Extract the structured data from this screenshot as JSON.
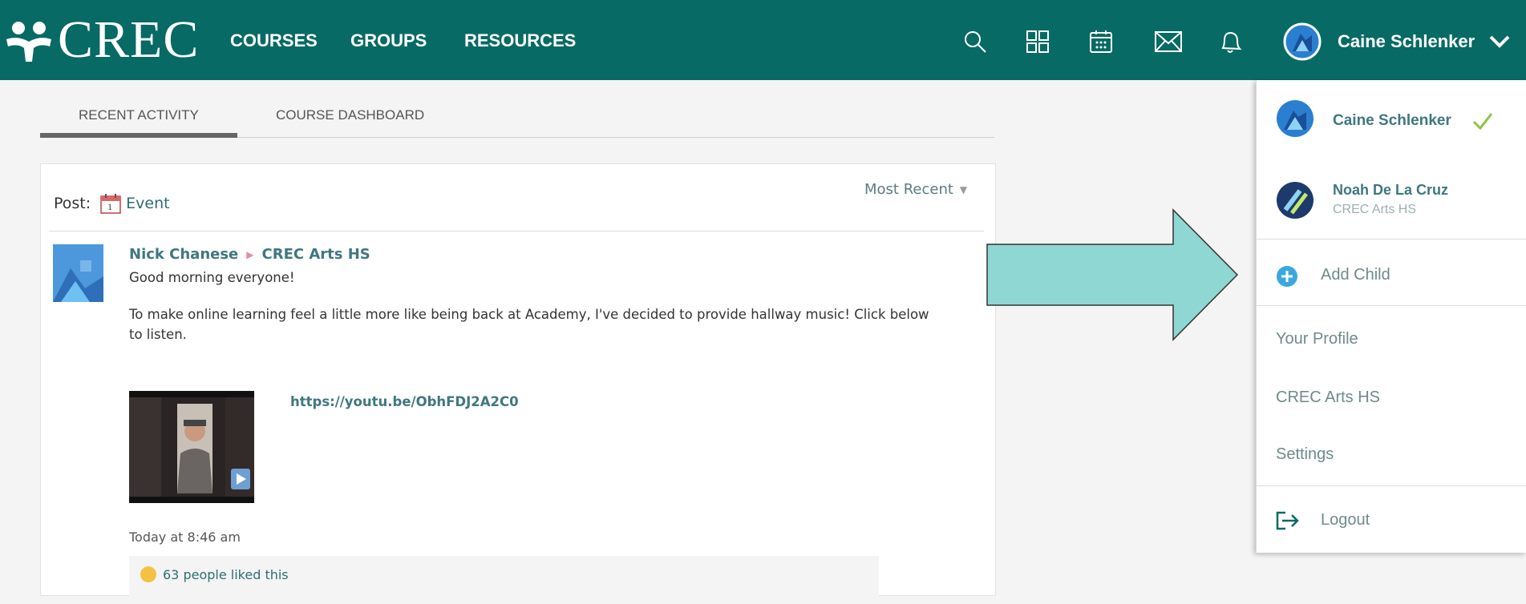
{
  "header": {
    "logo_text": "CREC",
    "nav": [
      "COURSES",
      "GROUPS",
      "RESOURCES"
    ],
    "icons": [
      "search-icon",
      "apps-grid-icon",
      "calendar-icon",
      "mail-icon",
      "notifications-bell-icon"
    ],
    "user_name": "Caine Schlenker",
    "brand_color": "#086a64"
  },
  "tabs": {
    "recent": "RECENT ACTIVITY",
    "dashboard": "COURSE DASHBOARD"
  },
  "post": {
    "label": "Post:",
    "calendar_day": "1",
    "type": "Event",
    "sort": "Most Recent",
    "author": "Nick Chanese",
    "group": "CREC Arts HS",
    "line1": "Good morning everyone!",
    "line2": "To make online learning feel a little more like being back at Academy, I've decided to provide hallway music! Click below",
    "line3": "to listen.",
    "url": "https://youtu.be/ObhFDJ2A2C0",
    "timestamp": "Today at 8:46 am",
    "likes": "63 people liked this"
  },
  "dropdown": {
    "current_user": "Caine Schlenker",
    "child_name": "Noah De La Cruz",
    "child_school": "CREC Arts HS",
    "add_child": "Add Child",
    "profile": "Your Profile",
    "school": "CREC Arts HS",
    "settings": "Settings",
    "logout": "Logout"
  }
}
